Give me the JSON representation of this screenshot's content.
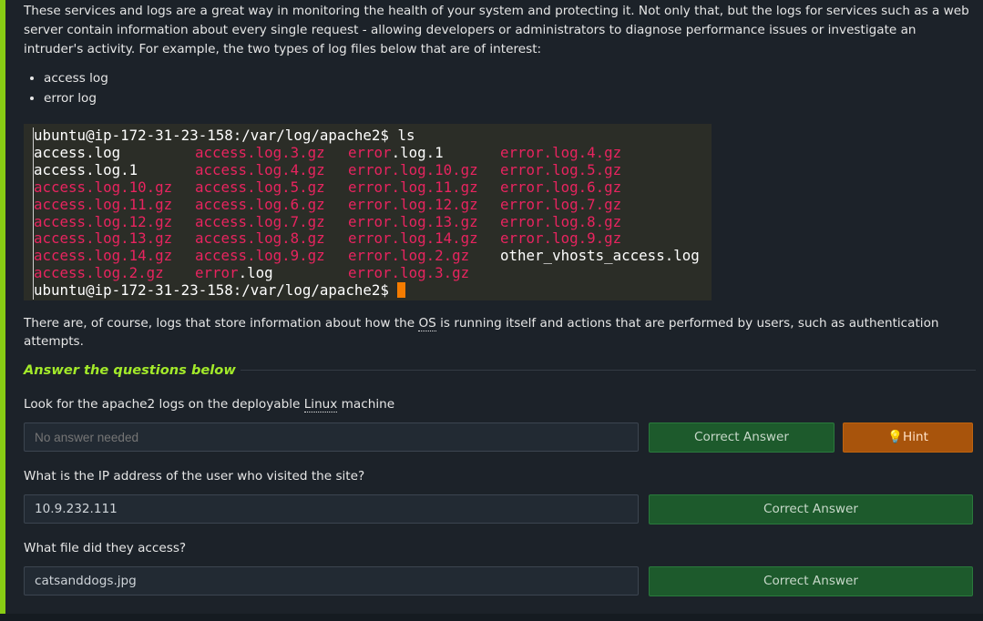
{
  "intro_text": "These services and logs are a great way in monitoring the health of your system and protecting it. Not only that, but the logs for services such as a web server contain information about every single request - allowing developers or administrators to diagnose performance issues or investigate an intruder's activity. For example, the two types of log files below that are of interest:",
  "bullets": [
    "access log",
    "error log"
  ],
  "terminal": {
    "prompt": "ubuntu@ip-172-31-23-158:/var/log/apache2$",
    "command": "ls",
    "files": [
      [
        "access.log",
        "access.log.3.gz",
        "error.log.1",
        "error.log.4.gz"
      ],
      [
        "access.log.1",
        "access.log.4.gz",
        "error.log.10.gz",
        "error.log.5.gz"
      ],
      [
        "access.log.10.gz",
        "access.log.5.gz",
        "error.log.11.gz",
        "error.log.6.gz"
      ],
      [
        "access.log.11.gz",
        "access.log.6.gz",
        "error.log.12.gz",
        "error.log.7.gz"
      ],
      [
        "access.log.12.gz",
        "access.log.7.gz",
        "error.log.13.gz",
        "error.log.8.gz"
      ],
      [
        "access.log.13.gz",
        "access.log.8.gz",
        "error.log.14.gz",
        "error.log.9.gz"
      ],
      [
        "access.log.14.gz",
        "access.log.9.gz",
        "error.log.2.gz",
        "other_vhosts_access.log"
      ],
      [
        "access.log.2.gz",
        "error.log",
        "error.log.3.gz",
        ""
      ]
    ],
    "colors": {
      "archive": "#e8245f",
      "plain": "#ffffff",
      "cursor": "#f57c00"
    }
  },
  "para2": {
    "before": "There are, of course, logs that store information about how the ",
    "os": "OS",
    "after": " is running itself and actions that are performed by users, such as authentication attempts."
  },
  "answer_section": {
    "title": "Answer the questions below",
    "accent": "#a3ea2a"
  },
  "questions": [
    {
      "q_before": "Look for the apache2 logs on the deployable ",
      "q_link": "Linux",
      "q_after": " machine",
      "answer": "",
      "placeholder": "No answer needed",
      "button": "Correct Answer",
      "hint": "Hint"
    },
    {
      "q_before": "What is the IP address of the user who visited the site?",
      "answer": "10.9.232.111",
      "button": "Correct Answer"
    },
    {
      "q_before": "What file did they access?",
      "answer": "catsanddogs.jpg",
      "button": "Correct Answer"
    }
  ]
}
